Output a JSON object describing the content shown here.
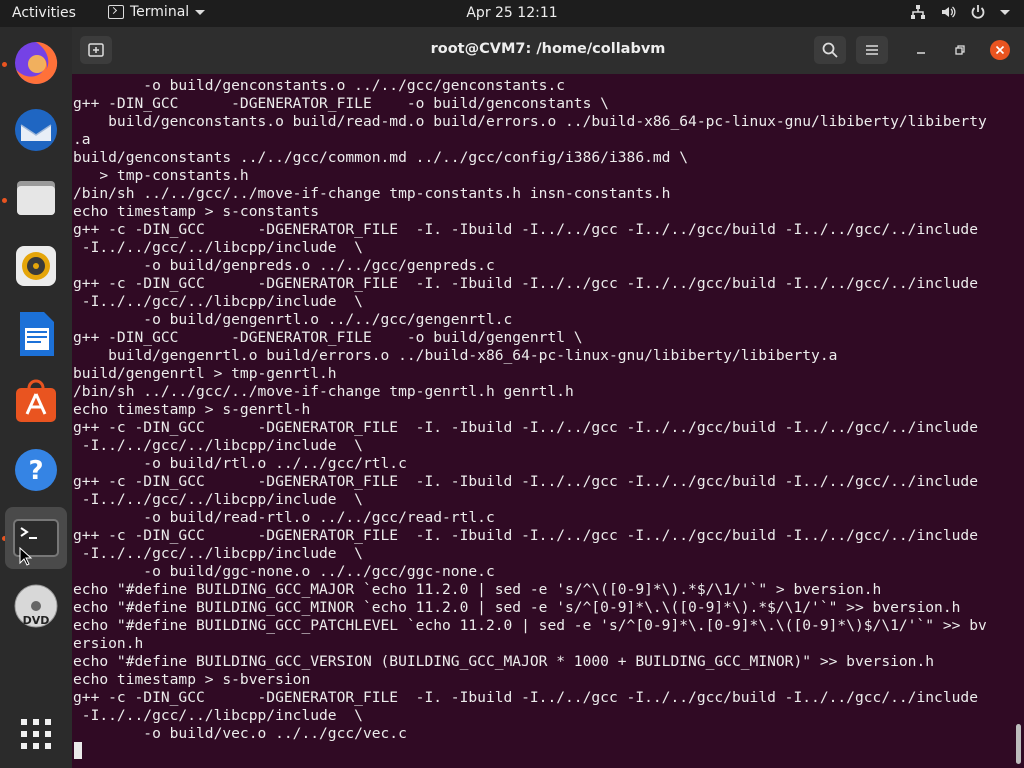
{
  "topbar": {
    "activities": "Activities",
    "app_name": "Terminal",
    "datetime": "Apr 25  12:11"
  },
  "dock": {
    "items": [
      "Firefox",
      "Thunderbird",
      "Files",
      "Rhythmbox",
      "LibreOffice Writer",
      "Ubuntu Software",
      "Help",
      "Terminal",
      "DVD"
    ],
    "show_apps": "Show Applications"
  },
  "window": {
    "title": "root@CVM7: /home/collabvm"
  },
  "terminal": {
    "lines": [
      "        -o build/genconstants.o ../../gcc/genconstants.c",
      "g++ -DIN_GCC      -DGENERATOR_FILE    -o build/genconstants \\",
      "    build/genconstants.o build/read-md.o build/errors.o ../build-x86_64-pc-linux-gnu/libiberty/libiberty",
      ".a",
      "build/genconstants ../../gcc/common.md ../../gcc/config/i386/i386.md \\",
      "   > tmp-constants.h",
      "/bin/sh ../../gcc/../move-if-change tmp-constants.h insn-constants.h",
      "echo timestamp > s-constants",
      "g++ -c -DIN_GCC      -DGENERATOR_FILE  -I. -Ibuild -I../../gcc -I../../gcc/build -I../../gcc/../include",
      " -I../../gcc/../libcpp/include  \\",
      "        -o build/genpreds.o ../../gcc/genpreds.c",
      "g++ -c -DIN_GCC      -DGENERATOR_FILE  -I. -Ibuild -I../../gcc -I../../gcc/build -I../../gcc/../include",
      " -I../../gcc/../libcpp/include  \\",
      "        -o build/gengenrtl.o ../../gcc/gengenrtl.c",
      "g++ -DIN_GCC      -DGENERATOR_FILE    -o build/gengenrtl \\",
      "    build/gengenrtl.o build/errors.o ../build-x86_64-pc-linux-gnu/libiberty/libiberty.a",
      "build/gengenrtl > tmp-genrtl.h",
      "/bin/sh ../../gcc/../move-if-change tmp-genrtl.h genrtl.h",
      "echo timestamp > s-genrtl-h",
      "g++ -c -DIN_GCC      -DGENERATOR_FILE  -I. -Ibuild -I../../gcc -I../../gcc/build -I../../gcc/../include",
      " -I../../gcc/../libcpp/include  \\",
      "        -o build/rtl.o ../../gcc/rtl.c",
      "g++ -c -DIN_GCC      -DGENERATOR_FILE  -I. -Ibuild -I../../gcc -I../../gcc/build -I../../gcc/../include",
      " -I../../gcc/../libcpp/include  \\",
      "        -o build/read-rtl.o ../../gcc/read-rtl.c",
      "g++ -c -DIN_GCC      -DGENERATOR_FILE  -I. -Ibuild -I../../gcc -I../../gcc/build -I../../gcc/../include",
      " -I../../gcc/../libcpp/include  \\",
      "        -o build/ggc-none.o ../../gcc/ggc-none.c",
      "echo \"#define BUILDING_GCC_MAJOR `echo 11.2.0 | sed -e 's/^\\([0-9]*\\).*$/\\1/'`\" > bversion.h",
      "echo \"#define BUILDING_GCC_MINOR `echo 11.2.0 | sed -e 's/^[0-9]*\\.\\([0-9]*\\).*$/\\1/'`\" >> bversion.h",
      "echo \"#define BUILDING_GCC_PATCHLEVEL `echo 11.2.0 | sed -e 's/^[0-9]*\\.[0-9]*\\.\\([0-9]*\\)$/\\1/'`\" >> bv",
      "ersion.h",
      "echo \"#define BUILDING_GCC_VERSION (BUILDING_GCC_MAJOR * 1000 + BUILDING_GCC_MINOR)\" >> bversion.h",
      "echo timestamp > s-bversion",
      "g++ -c -DIN_GCC      -DGENERATOR_FILE  -I. -Ibuild -I../../gcc -I../../gcc/build -I../../gcc/../include",
      " -I../../gcc/../libcpp/include  \\",
      "        -o build/vec.o ../../gcc/vec.c"
    ]
  }
}
